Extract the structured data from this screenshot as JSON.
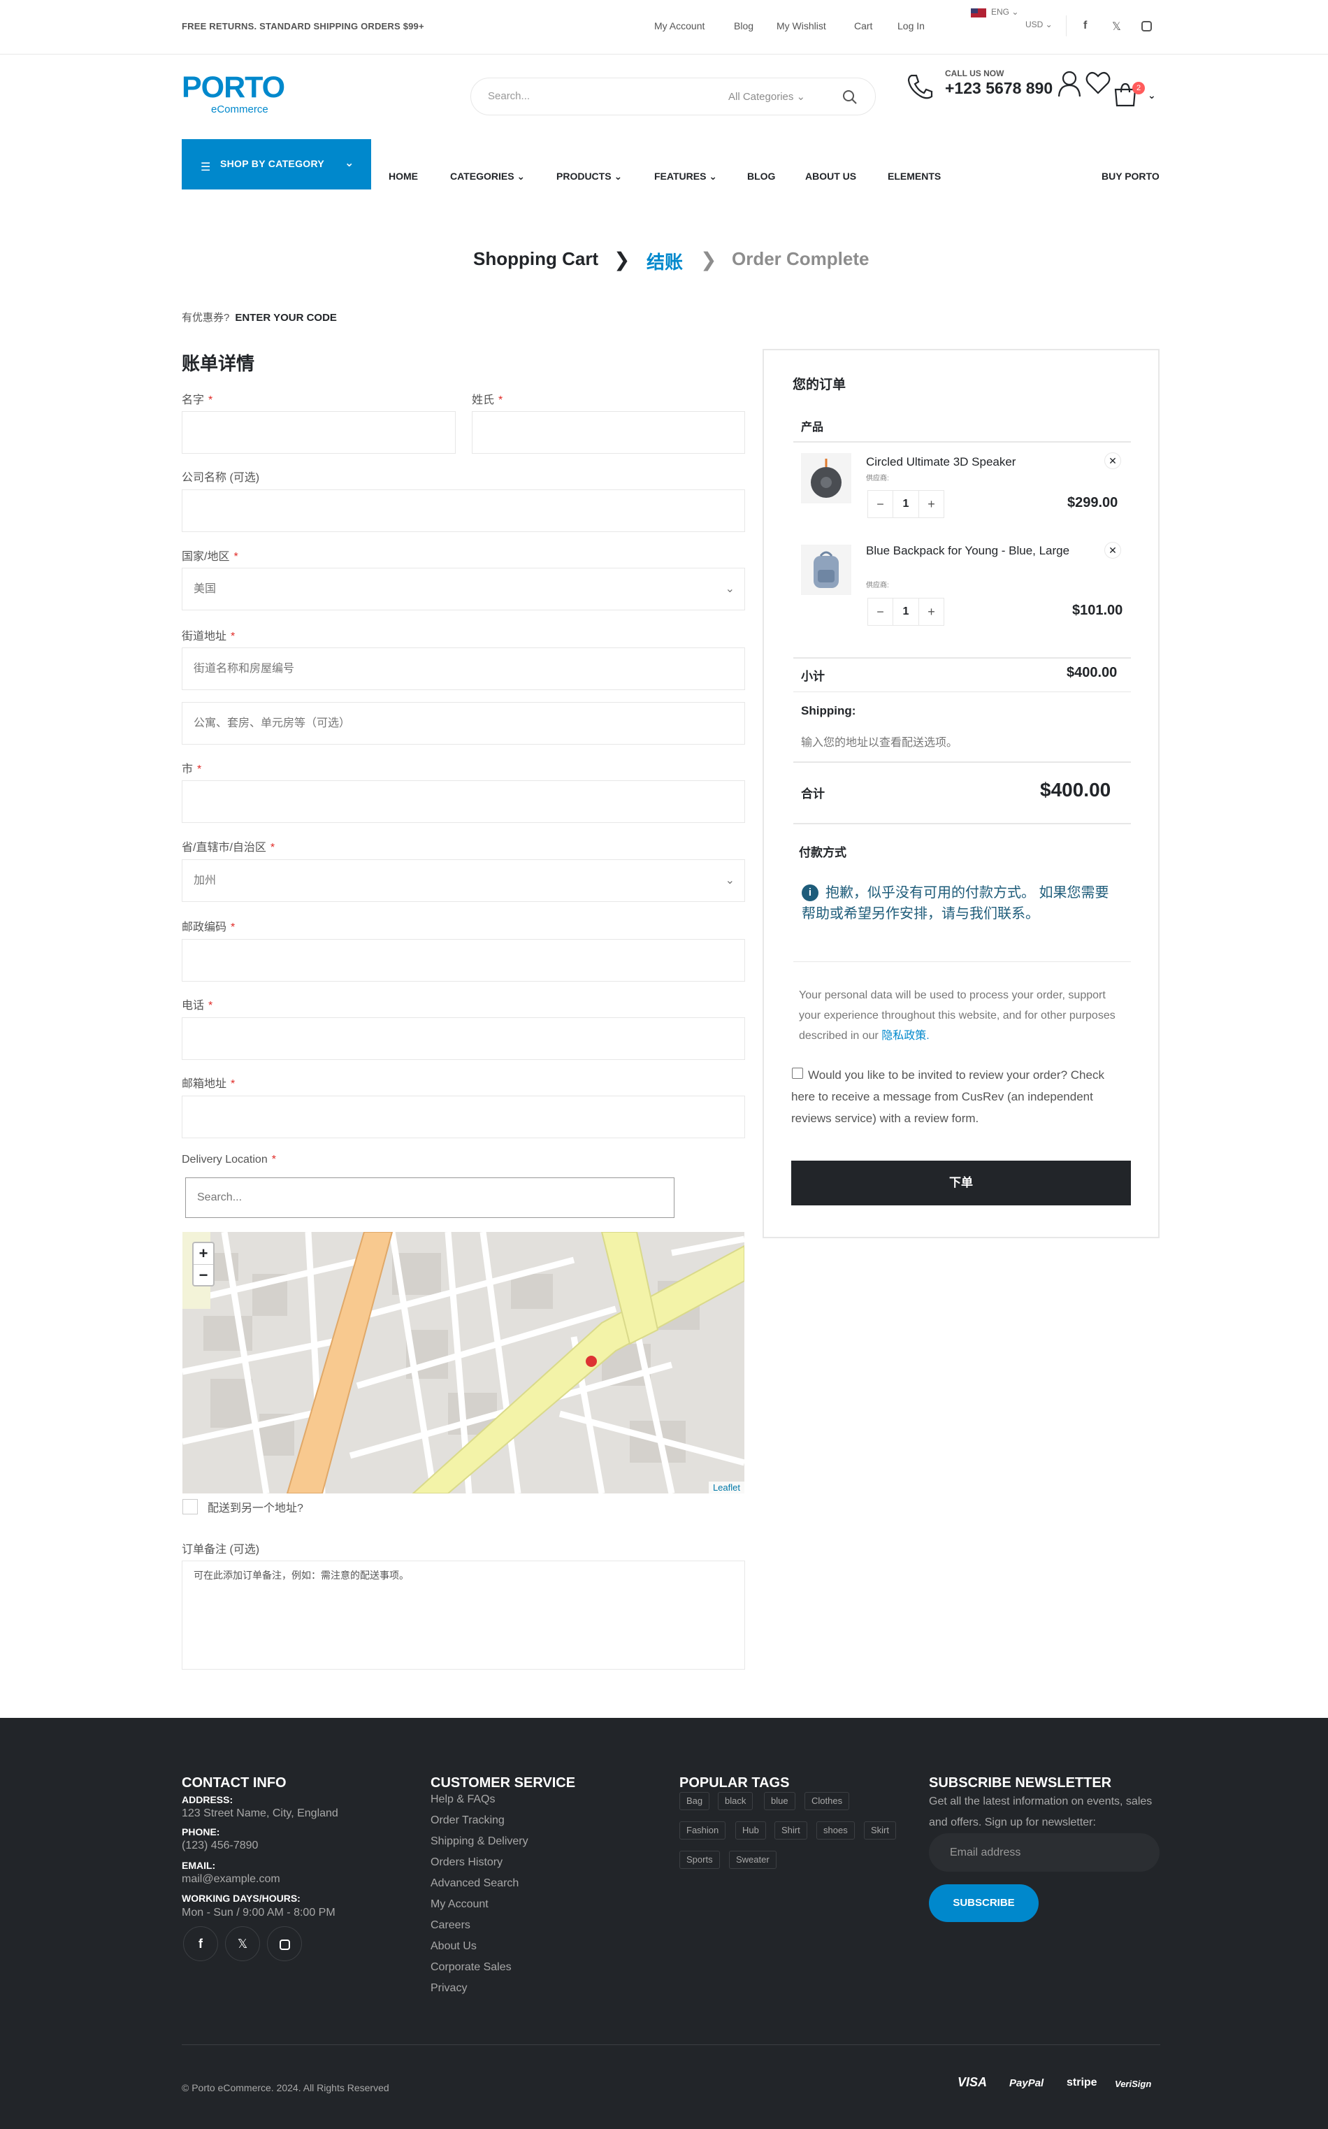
{
  "topbar": {
    "message": "FREE RETURNS. STANDARD SHIPPING ORDERS $99+",
    "links": [
      "My Account",
      "Blog",
      "My Wishlist",
      "Cart",
      "Log In"
    ],
    "lang": "ENG",
    "currency": "USD"
  },
  "header": {
    "logo": "PORTO",
    "logo_sub": "eCommerce",
    "search_placeholder": "Search...",
    "search_category": "All Categories",
    "call_label": "CALL US NOW",
    "call_number": "+123 5678 890",
    "cart_count": "2"
  },
  "nav": {
    "shop_by_category": "SHOP BY CATEGORY",
    "items": [
      "HOME",
      "CATEGORIES",
      "PRODUCTS",
      "FEATURES",
      "BLOG",
      "ABOUT US",
      "ELEMENTS"
    ],
    "buy": "BUY PORTO"
  },
  "steps": [
    "Shopping Cart",
    "结账",
    "Order Complete"
  ],
  "coupon": {
    "question": "有优惠券?",
    "link": "ENTER YOUR CODE"
  },
  "billing": {
    "title": "账单详情",
    "first_name": "名字",
    "last_name": "姓氏",
    "company": "公司名称 (可选)",
    "country": "国家/地区",
    "country_value": "美国",
    "street": "街道地址",
    "street_ph": "街道名称和房屋编号",
    "street2_ph": "公寓、套房、单元房等（可选）",
    "city": "市",
    "state": "省/直辖市/自治区",
    "state_value": "加州",
    "zip": "邮政编码",
    "phone": "电话",
    "email": "邮箱地址",
    "delivery": "Delivery Location",
    "delivery_ph": "Search...",
    "map_attribution": "Leaflet",
    "ship_other": "配送到另一个地址?",
    "notes_label": "订单备注 (可选)",
    "notes_ph": "可在此添加订单备注，例如：需注意的配送事项。"
  },
  "order": {
    "title": "您的订单",
    "col_product": "产品",
    "items": [
      {
        "name": "Circled Ultimate 3D Speaker",
        "meta": "供应商:",
        "qty": "1",
        "price": "$299.00"
      },
      {
        "name": "Blue Backpack for Young - Blue, Large",
        "meta": "供应商:",
        "qty": "1",
        "price": "$101.00"
      }
    ],
    "subtotal_label": "小计",
    "subtotal": "$400.00",
    "shipping_label": "Shipping:",
    "shipping_note": "输入您的地址以查看配送选项。",
    "total_label": "合计",
    "total": "$400.00",
    "payment_title": "付款方式",
    "payment_note": "抱歉，似乎没有可用的付款方式。 如果您需要帮助或希望另作安排，请与我们联系。",
    "privacy": "Your personal data will be used to process your order, support your experience throughout this website, and for other purposes described in our ",
    "privacy_link": "隐私政策.",
    "review": "Would you like to be invited to review your order? Check here to receive a message from CusRev (an independent reviews service) with a review form.",
    "place_order": "下单"
  },
  "footer": {
    "contact_title": "CONTACT INFO",
    "address_label": "ADDRESS:",
    "address": "123 Street Name, City, England",
    "phone_label": "PHONE:",
    "phone": "(123) 456-7890",
    "email_label": "EMAIL:",
    "email": "mail@example.com",
    "hours_label": "WORKING DAYS/HOURS:",
    "hours": "Mon - Sun / 9:00 AM - 8:00 PM",
    "service_title": "CUSTOMER SERVICE",
    "service_links": [
      "Help & FAQs",
      "Order Tracking",
      "Shipping & Delivery",
      "Orders History",
      "Advanced Search",
      "My Account",
      "Careers",
      "About Us",
      "Corporate Sales",
      "Privacy"
    ],
    "tags_title": "POPULAR TAGS",
    "tags": [
      "Bag",
      "black",
      "blue",
      "Clothes",
      "Fashion",
      "Hub",
      "Shirt",
      "shoes",
      "Skirt",
      "Sports",
      "Sweater"
    ],
    "news_title": "SUBSCRIBE NEWSLETTER",
    "news_text": "Get all the latest information on events, sales and offers. Sign up for newsletter:",
    "email_ph": "Email address",
    "subscribe": "SUBSCRIBE",
    "copyright": "© Porto eCommerce. 2024. All Rights Reserved",
    "payments": [
      "VISA",
      "PayPal",
      "stripe",
      "VeriSign"
    ]
  },
  "colors": {
    "primary": "#0088cc",
    "dark": "#222529",
    "required": "#e02b27",
    "badge": "#ff5b5b"
  }
}
